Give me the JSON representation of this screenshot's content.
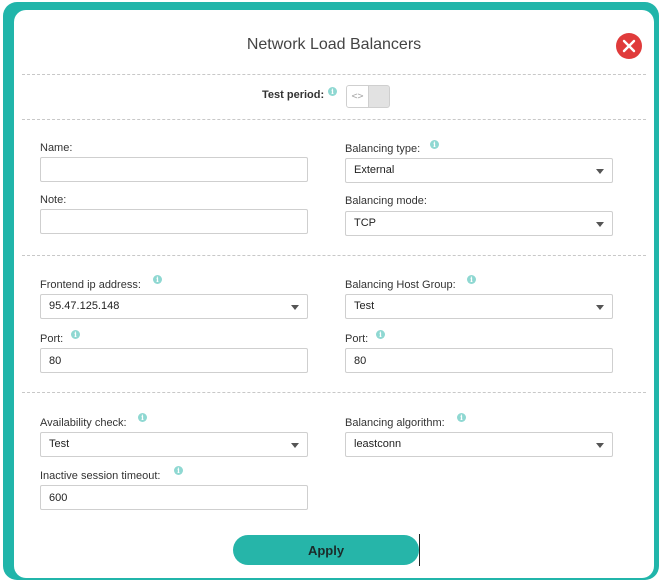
{
  "dialog": {
    "title": "Network Load Balancers"
  },
  "test_period": {
    "label": "Test period:",
    "toggle_glyph": "<>"
  },
  "fields": {
    "name": {
      "label": "Name:",
      "value": ""
    },
    "note": {
      "label": "Note:",
      "value": ""
    },
    "balancing_type": {
      "label": "Balancing type:",
      "value": "External"
    },
    "balancing_mode": {
      "label": "Balancing mode:",
      "value": "TCP"
    },
    "frontend_ip": {
      "label": "Frontend ip address:",
      "value": "95.47.125.148"
    },
    "frontend_port": {
      "label": "Port:",
      "value": "80"
    },
    "host_group": {
      "label": "Balancing Host Group:",
      "value": "Test"
    },
    "backend_port": {
      "label": "Port:",
      "value": "80"
    },
    "availability_check": {
      "label": "Availability check:",
      "value": "Test"
    },
    "balancing_algorithm": {
      "label": "Balancing algorithm:",
      "value": "leastconn"
    },
    "inactive_timeout": {
      "label": "Inactive session timeout:",
      "value": "600"
    }
  },
  "info_glyph": "i",
  "apply_label": "Apply",
  "colors": {
    "frame": "#21b5aa",
    "button": "#26b5a9",
    "close": "#e03b3b",
    "info": "#8fd8d2"
  }
}
